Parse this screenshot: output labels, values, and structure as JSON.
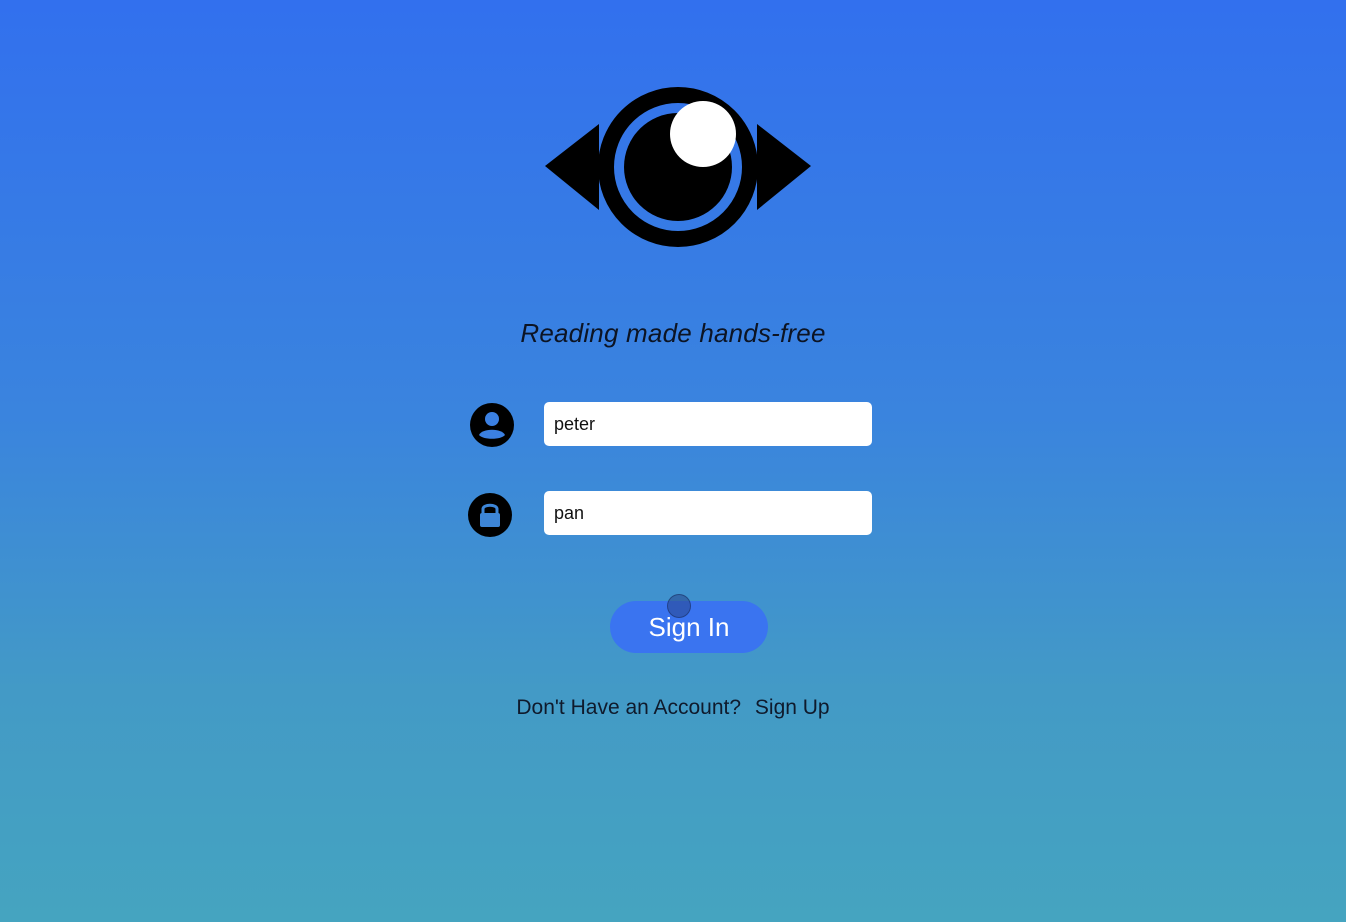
{
  "branding": {
    "logo_icon": "eye-logo-icon",
    "tagline": "Reading made hands-free"
  },
  "login_form": {
    "username_icon": "user-circle-icon",
    "username_value": "peter",
    "password_icon": "lock-icon",
    "password_value": "pan",
    "signin_label": "Sign In"
  },
  "signup": {
    "prompt": "Don't Have an Account?",
    "link_label": "Sign Up"
  },
  "colors": {
    "background_top": "#3270ee",
    "background_bottom": "#45a4c0",
    "button": "#3a74f0",
    "field_background": "#ffffff",
    "text_dark": "#0c1424"
  }
}
